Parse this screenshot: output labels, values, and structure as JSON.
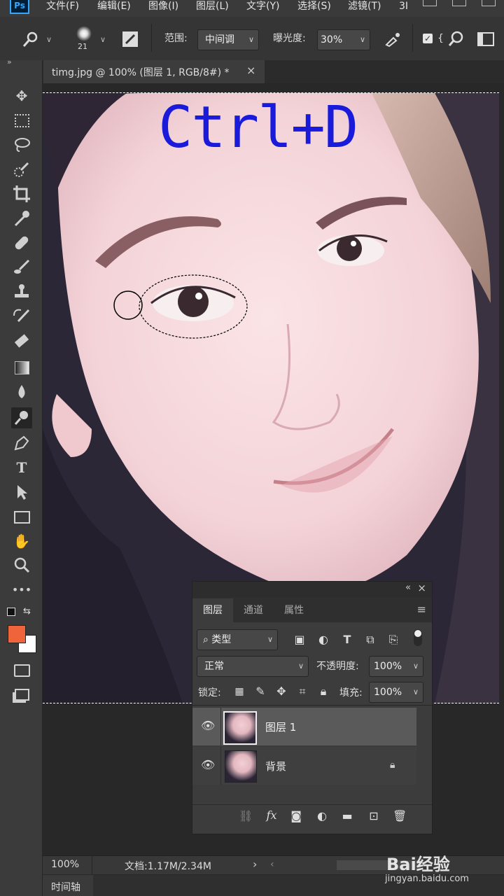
{
  "app": {
    "logo": "Ps"
  },
  "menu": [
    "文件(F)",
    "编辑(E)",
    "图像(I)",
    "图层(L)",
    "文字(Y)",
    "选择(S)",
    "滤镜(T)",
    "3I"
  ],
  "options": {
    "brush_size": "21",
    "range_label": "范围:",
    "range_value": "中间调",
    "exposure_label": "曝光度:",
    "exposure_value": "30%",
    "protect_checked": true
  },
  "document_tab": {
    "title": "timg.jpg @ 100% (图层 1, RGB/8#) *",
    "close": "×"
  },
  "canvas": {
    "overlay_text": "Ctrl+D",
    "overlay_color": "#1a1adb"
  },
  "tools": [
    "move-icon",
    "marquee-icon",
    "lasso-icon",
    "quick-select-icon",
    "crop-icon",
    "eyedropper-icon",
    "healing-icon",
    "brush-icon",
    "stamp-icon",
    "history-brush-icon",
    "eraser-icon",
    "gradient-icon",
    "blur-icon",
    "dodge-icon",
    "pen-icon",
    "type-icon",
    "path-select-icon",
    "rectangle-icon",
    "hand-icon",
    "zoom-icon",
    "more-icon"
  ],
  "colors": {
    "foreground": "#f0643c",
    "background": "#ffffff",
    "accent": "#31a8ff"
  },
  "layers_panel": {
    "tabs": [
      "图层",
      "通道",
      "属性"
    ],
    "filter_kind": "类型",
    "blend_mode": "正常",
    "opacity_label": "不透明度:",
    "opacity_value": "100%",
    "lock_label": "锁定:",
    "fill_label": "填充:",
    "fill_value": "100%",
    "collapse": "«",
    "close": "×",
    "layers": [
      {
        "name": "图层 1",
        "selected": true,
        "locked": false
      },
      {
        "name": "背景",
        "selected": false,
        "locked": true
      }
    ],
    "footer_fx": "fx"
  },
  "status": {
    "zoom": "100%",
    "doc_info": "文档:1.17M/2.34M",
    "arrow": "›"
  },
  "timeline": {
    "label": "时间轴"
  },
  "watermark": {
    "brand": "Bai经验",
    "url": "jingyan.baidu.com"
  }
}
